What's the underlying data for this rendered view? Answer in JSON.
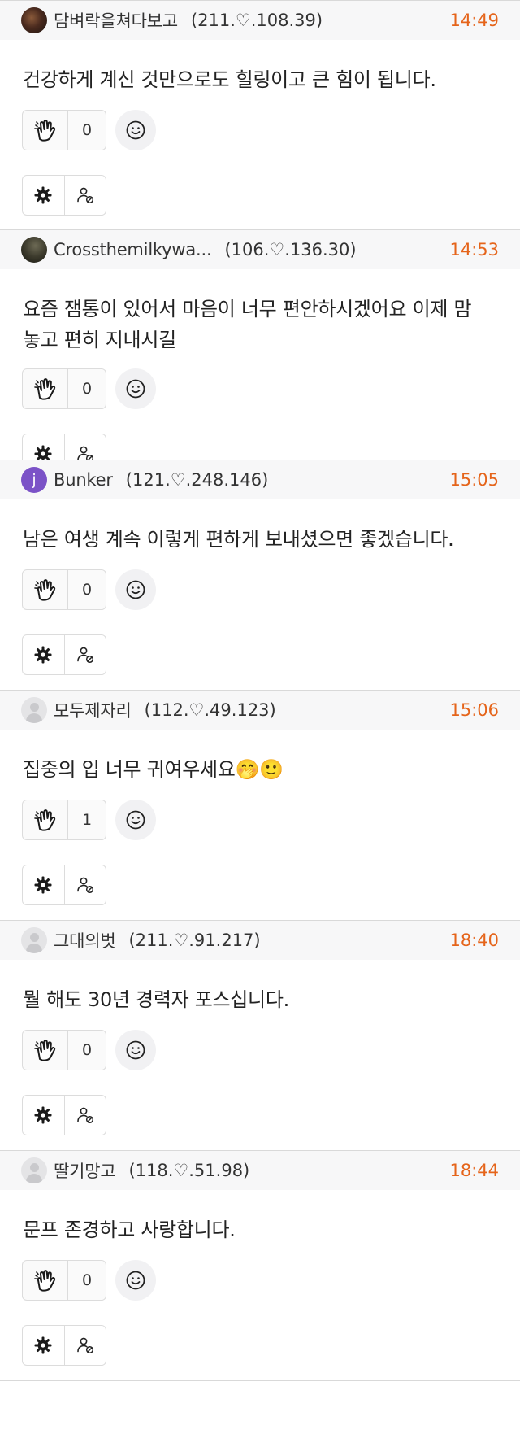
{
  "comments": [
    {
      "nickname": "담벼락을쳐다보고",
      "ip": "(211.♡.108.39)",
      "time": "14:49",
      "avatar": "photo-dark",
      "lines": [
        "건강하게 계신 것만으로도 힐링이고 큰 힘이 됩니다."
      ],
      "likes": "0"
    },
    {
      "nickname": "Crossthemilkywa...",
      "ip": "(106.♡.136.30)",
      "time": "14:53",
      "avatar": "photo-earth",
      "lines": [
        "요즘 잼통이 있어서 마음이 너무 편안하시겠어요 이제 맘",
        "놓고 편히 지내시길"
      ],
      "likes": "0"
    },
    {
      "nickname": "Bunker",
      "ip": "(121.♡.248.146)",
      "time": "15:05",
      "avatar": "letter",
      "avatar_letter": "j",
      "lines": [
        "남은 여생 계속 이렇게 편하게 보내셨으면 좋겠습니다."
      ],
      "likes": "0"
    },
    {
      "nickname": "모두제자리",
      "ip": "(112.♡.49.123)",
      "time": "15:06",
      "avatar": "default",
      "lines": [
        "집중의 입 너무 귀여우세요🤭🙂"
      ],
      "likes": "1"
    },
    {
      "nickname": "그대의벗",
      "ip": "(211.♡.91.217)",
      "time": "18:40",
      "avatar": "default",
      "lines": [
        "뭘 해도 30년 경력자 포스십니다."
      ],
      "likes": "0"
    },
    {
      "nickname": "딸기망고",
      "ip": "(118.♡.51.98)",
      "time": "18:44",
      "avatar": "default",
      "lines": [
        "문프 존경하고 사랑합니다."
      ],
      "likes": "0"
    }
  ],
  "icons": {
    "like": "clapping-hand-icon",
    "emoji": "smiley-face-icon",
    "settings": "gear-icon",
    "block_user": "user-block-icon"
  },
  "colors": {
    "time": "#e5641a",
    "header_bg": "#f7f7f8",
    "letter_avatar": "#7b52c7"
  }
}
